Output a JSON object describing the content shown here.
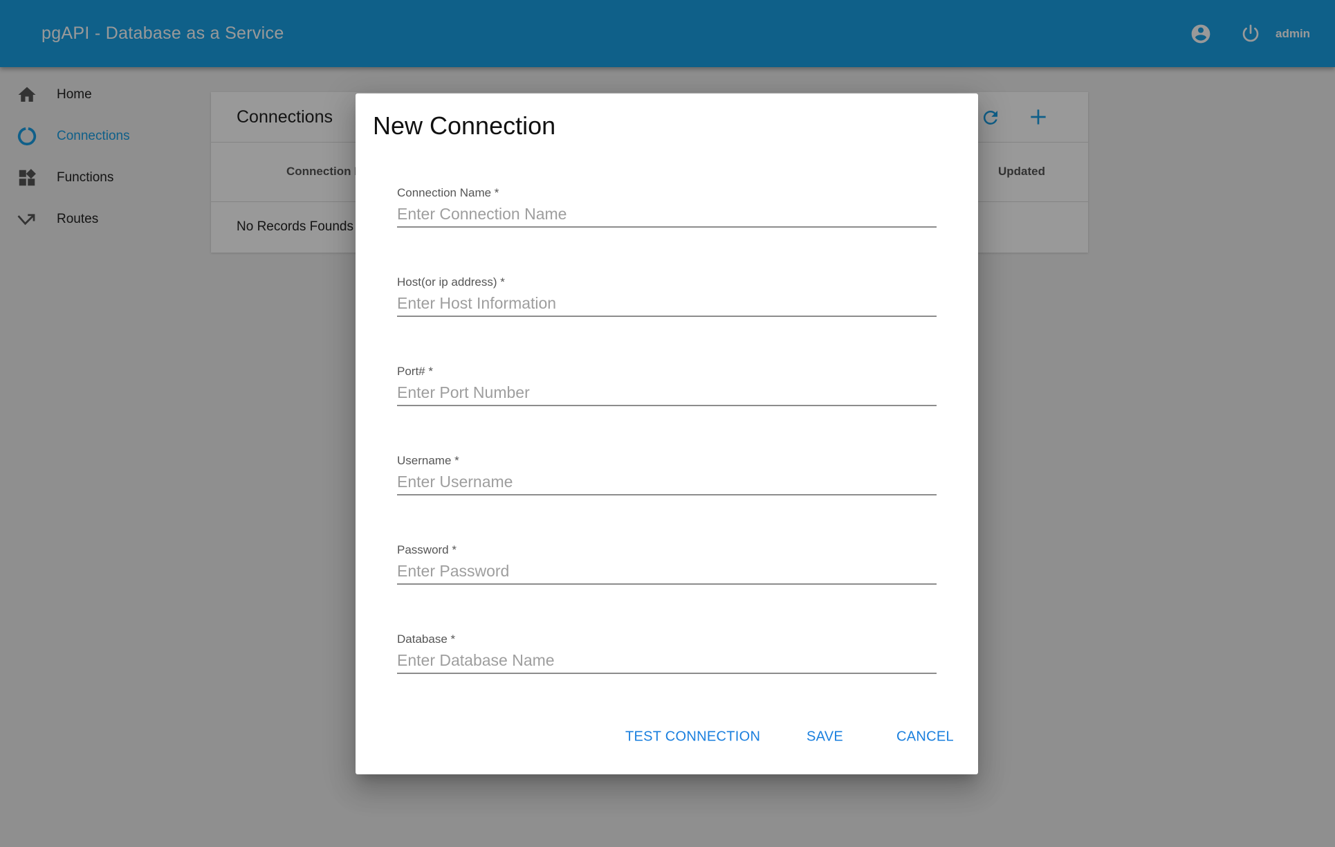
{
  "app": {
    "title": "pgAPI - Database as a Service",
    "user": "admin",
    "icons": {
      "account": "account-circle-icon",
      "power": "power-icon"
    }
  },
  "sidebar": {
    "items": [
      {
        "label": "Home",
        "icon": "home-icon",
        "active": false
      },
      {
        "label": "Connections",
        "icon": "connections-ring-icon",
        "active": true
      },
      {
        "label": "Functions",
        "icon": "widgets-icon",
        "active": false
      },
      {
        "label": "Routes",
        "icon": "trending-route-icon",
        "active": false
      }
    ]
  },
  "card": {
    "title": "Connections",
    "columns": [
      "Connection Name",
      "Updated"
    ],
    "empty_text": "No Records Founds",
    "actions": {
      "refresh": "refresh-icon",
      "add": "add-icon"
    }
  },
  "dialog": {
    "title": "New Connection",
    "fields": [
      {
        "label": "Connection Name *",
        "placeholder": "Enter Connection Name",
        "value": ""
      },
      {
        "label": "Host(or ip address) *",
        "placeholder": "Enter Host Information",
        "value": ""
      },
      {
        "label": "Port# *",
        "placeholder": "Enter Port Number",
        "value": ""
      },
      {
        "label": "Username *",
        "placeholder": "Enter Username",
        "value": ""
      },
      {
        "label": "Password *",
        "placeholder": "Enter Password",
        "value": ""
      },
      {
        "label": "Database *",
        "placeholder": "Enter Database Name",
        "value": ""
      }
    ],
    "buttons": {
      "test": "TEST CONNECTION",
      "save": "SAVE",
      "cancel": "CANCEL"
    }
  },
  "colors": {
    "primary": "#1aa0e4",
    "button_text": "#1a7fde"
  }
}
